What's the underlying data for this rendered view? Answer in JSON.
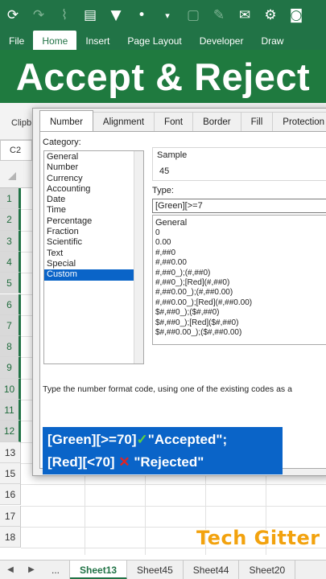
{
  "quick_access": {
    "icons": [
      "autosave-icon",
      "redo-icon",
      "chart-icon",
      "table-icon",
      "filter-icon",
      "dot-icon",
      "chevron-down-icon",
      "shapes-icon",
      "format-painter-icon",
      "comment-icon",
      "gear-icon",
      "camera-icon"
    ]
  },
  "ribbon_tabs": [
    "File",
    "Home",
    "Insert",
    "Page Layout",
    "Developer",
    "Draw"
  ],
  "active_ribbon_tab": "Home",
  "banner": {
    "title": "Accept & Reject"
  },
  "clipboard_label": "Clipb",
  "name_box": "C2",
  "row_numbers": [
    "1",
    "2",
    "3",
    "4",
    "5",
    "6",
    "7",
    "8",
    "9",
    "10",
    "11",
    "12",
    "13",
    "15",
    "16",
    "17",
    "18"
  ],
  "sheet_tabs": [
    "...",
    "Sheet13",
    "Sheet45",
    "Sheet44",
    "Sheet20"
  ],
  "active_sheet": "Sheet13",
  "dialog": {
    "tabs": [
      "Number",
      "Alignment",
      "Font",
      "Border",
      "Fill",
      "Protection"
    ],
    "category_label": "Category:",
    "categories": [
      "General",
      "Number",
      "Currency",
      "Accounting",
      "Date",
      "Time",
      "Percentage",
      "Fraction",
      "Scientific",
      "Text",
      "Special",
      "Custom"
    ],
    "selected_category": "Custom",
    "sample_label": "Sample",
    "sample_value": "45",
    "type_label": "Type:",
    "type_value": "[Green][>=7",
    "formats": [
      "General",
      "0",
      "0.00",
      "#,##0",
      "#,##0.00",
      "#,##0_);(#,##0)",
      "#,##0_);[Red](#,##0)",
      "#,##0.00_);(#,##0.00)",
      "#,##0.00_);[Red](#,##0.00)",
      "$#,##0_);($#,##0)",
      "$#,##0_);[Red]($#,##0)",
      "$#,##0.00_);($#,##0.00)"
    ],
    "hint": "Type the number format code, using one of the existing codes as a"
  },
  "annotation": {
    "line1_a": "[Green][>=70]",
    "line1_check": "✓",
    "line1_b": "\"Accepted\";",
    "line2_a": "[Red][<70]",
    "line2_x": "✕",
    "line2_b": "\"Rejected\""
  },
  "watermark": "Tech Gitter",
  "colors": {
    "excel_green": "#217346",
    "banner_green": "#1f7a3f",
    "selection_blue": "#0a64c8",
    "watermark_orange": "#f2a20e"
  }
}
